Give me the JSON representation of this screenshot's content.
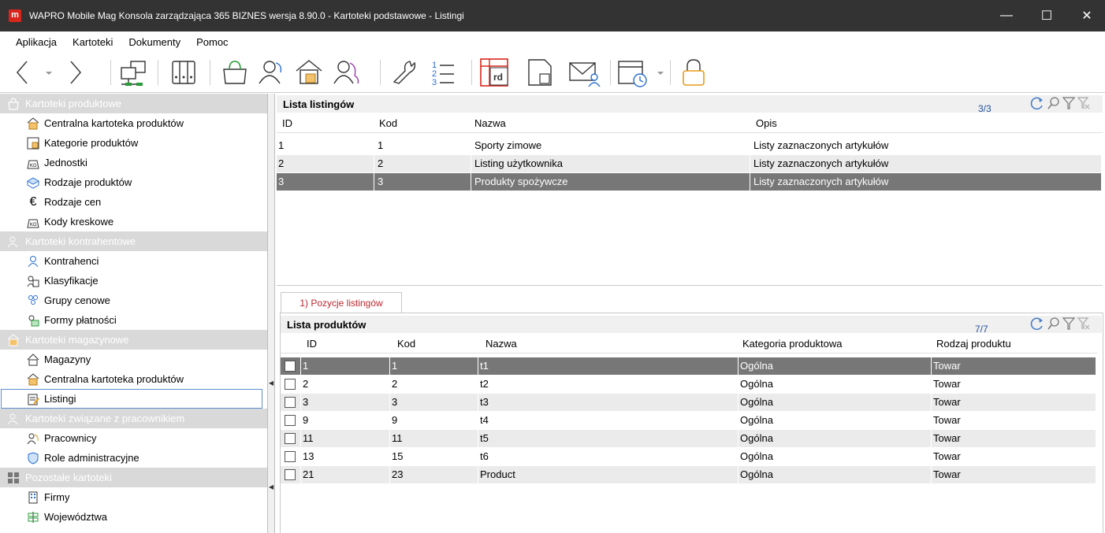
{
  "window": {
    "title": "WAPRO Mobile Mag Konsola zarządzająca 365 BIZNES wersja 8.90.0 - Kartoteki podstawowe - Listingi",
    "app_icon_letter": "m",
    "minimize": "—",
    "maximize": "☐",
    "close": "✕"
  },
  "menu": [
    "Aplikacja",
    "Kartoteki",
    "Dokumenty",
    "Pomoc"
  ],
  "toolbar": {
    "rd_label": "rd",
    "icons": [
      "back-arrow-icon",
      "forward-arrow-icon",
      "network-icon",
      "binders-icon",
      "shopping-bag-icon",
      "contractor-icon",
      "warehouse-icon",
      "employee-icon",
      "wrench-icon",
      "numbered-list-icon",
      "table-rd-icon",
      "document-icon",
      "envelope-user-icon",
      "calendar-clock-icon",
      "padlock-icon"
    ]
  },
  "sidebar": {
    "sections": [
      {
        "title": "Kartoteki produktowe",
        "icon": "shopping-bag-icon",
        "items": [
          {
            "label": "Centralna kartoteka produktów",
            "icon": "product-catalog-icon"
          },
          {
            "label": "Kategorie produktów",
            "icon": "categories-icon"
          },
          {
            "label": "Jednostki",
            "icon": "weight-kg-icon"
          },
          {
            "label": "Rodzaje produktów",
            "icon": "product-types-icon"
          },
          {
            "label": "Rodzaje cen",
            "icon": "euro-icon"
          },
          {
            "label": "Kody kreskowe",
            "icon": "barcode-kg-icon"
          }
        ]
      },
      {
        "title": "Kartoteki kontrahentowe",
        "icon": "contractor-icon",
        "items": [
          {
            "label": "Kontrahenci",
            "icon": "person-icon"
          },
          {
            "label": "Klasyfikacje",
            "icon": "classification-icon"
          },
          {
            "label": "Grupy cenowe",
            "icon": "price-groups-icon"
          },
          {
            "label": "Formy płatności",
            "icon": "payment-icon"
          }
        ]
      },
      {
        "title": "Kartoteki magazynowe",
        "icon": "warehouse-icon",
        "items": [
          {
            "label": "Magazyny",
            "icon": "house-icon"
          },
          {
            "label": "Centralna kartoteka produktów",
            "icon": "product-catalog-icon"
          },
          {
            "label": "Listingi",
            "icon": "listing-icon",
            "selected": true
          }
        ]
      },
      {
        "title": "Kartoteki związane z pracownikiem",
        "icon": "employee-icon",
        "items": [
          {
            "label": "Pracownicy",
            "icon": "workers-icon"
          },
          {
            "label": "Role administracyjne",
            "icon": "shield-icon"
          }
        ]
      },
      {
        "title": "Pozostałe kartoteki",
        "icon": "tiles-icon",
        "items": [
          {
            "label": "Firmy",
            "icon": "building-icon"
          },
          {
            "label": "Województwa",
            "icon": "signpost-icon"
          }
        ]
      }
    ]
  },
  "listings": {
    "title": "Lista listingów",
    "count": "3/3",
    "columns": [
      "ID",
      "Kod",
      "Nazwa",
      "Opis"
    ],
    "rows": [
      [
        "1",
        "1",
        "Sporty zimowe",
        "Listy zaznaczonych artykułów"
      ],
      [
        "2",
        "2",
        "Listing użytkownika",
        "Listy zaznaczonych artykułów"
      ],
      [
        "3",
        "3",
        "Produkty spożywcze",
        "Listy zaznaczonych artykułów"
      ]
    ],
    "selected_row": 2
  },
  "tab": {
    "label": "1) Pozycje listingów"
  },
  "products": {
    "title": "Lista produktów",
    "count": "7/7",
    "columns": [
      "ID",
      "Kod",
      "Nazwa",
      "Kategoria produktowa",
      "Rodzaj produktu"
    ],
    "rows": [
      [
        "1",
        "1",
        "t1",
        "Ogólna",
        "Towar"
      ],
      [
        "2",
        "2",
        "t2",
        "Ogólna",
        "Towar"
      ],
      [
        "3",
        "3",
        "t3",
        "Ogólna",
        "Towar"
      ],
      [
        "9",
        "9",
        "t4",
        "Ogólna",
        "Towar"
      ],
      [
        "11",
        "11",
        "t5",
        "Ogólna",
        "Towar"
      ],
      [
        "13",
        "15",
        "t6",
        "Ogólna",
        "Towar"
      ],
      [
        "21",
        "23",
        "Product",
        "Ogólna",
        "Towar"
      ]
    ],
    "selected_row": 0
  },
  "colors": {
    "accent_red": "#d9261c",
    "title_bar": "#333333",
    "selection": "#777777",
    "section_header": "#d9d9d9"
  }
}
